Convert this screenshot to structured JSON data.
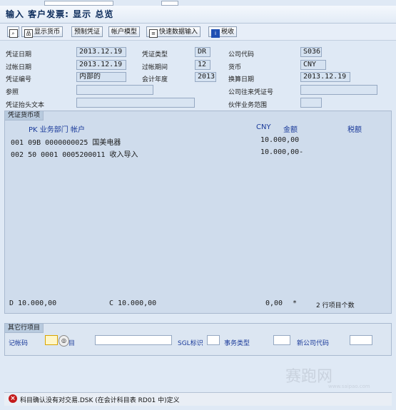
{
  "window": {
    "title": "输入 客户发票: 显示 总览"
  },
  "toolbar": {
    "display_currency": "显示货币",
    "park_document": "预制凭证",
    "account_model": "帐户模型",
    "fast_entry": "快速数据输入",
    "tax": "税收"
  },
  "header": {
    "doc_date_label": "凭证日期",
    "doc_date": "2013.12.19",
    "doc_type_label": "凭证类型",
    "doc_type": "DR",
    "company_code_label": "公司代码",
    "company_code": "S036",
    "posting_date_label": "过帐日期",
    "posting_date": "2013.12.19",
    "period_label": "过帐期间",
    "period": "12",
    "currency_label": "货币",
    "currency": "CNY",
    "doc_number_label": "凭证编号",
    "doc_number": "内部的",
    "fiscal_year_label": "会计年度",
    "fiscal_year": "2013",
    "translation_date_label": "换算日期",
    "translation_date": "2013.12.19",
    "reference_label": "参照",
    "reference": "",
    "intercompany_label": "公司往来凭证号",
    "intercompany": "",
    "header_text_label": "凭证抬头文本",
    "header_text": "",
    "partner_area_label": "伙伴业务范围",
    "partner_area": ""
  },
  "items_panel": {
    "tab": "凭证货币项",
    "col_pk_dept_acct": "PK  业务部门  帐户",
    "col_currency": "CNY",
    "col_amount": "金额",
    "col_tax": "税额",
    "rows": [
      {
        "left": "001 09B      0000000025 国美电器",
        "amount": "10.000,00"
      },
      {
        "left": "002 50   0001 0005200011 收入导入",
        "amount": "10.000,00-"
      }
    ],
    "debit_label": "D",
    "debit_total": "10.000,00",
    "credit_label": "C",
    "credit_total": "10.000,00",
    "balance": "0,00",
    "balance_flag": "*",
    "item_count": "2 行项目个数"
  },
  "other_item": {
    "tab": "其它行项目",
    "posting_key_label": "记帐码",
    "account_label": "目",
    "sgl_label": "SGL标识",
    "trans_type_label": "事务类型",
    "new_company_label": "新公司代码"
  },
  "status": {
    "message": "科目确认没有对交易.DSK  (在会计科目表 RD01 中)定义"
  },
  "watermark": {
    "text": "赛跑网",
    "sub": "www.saipao.com"
  }
}
